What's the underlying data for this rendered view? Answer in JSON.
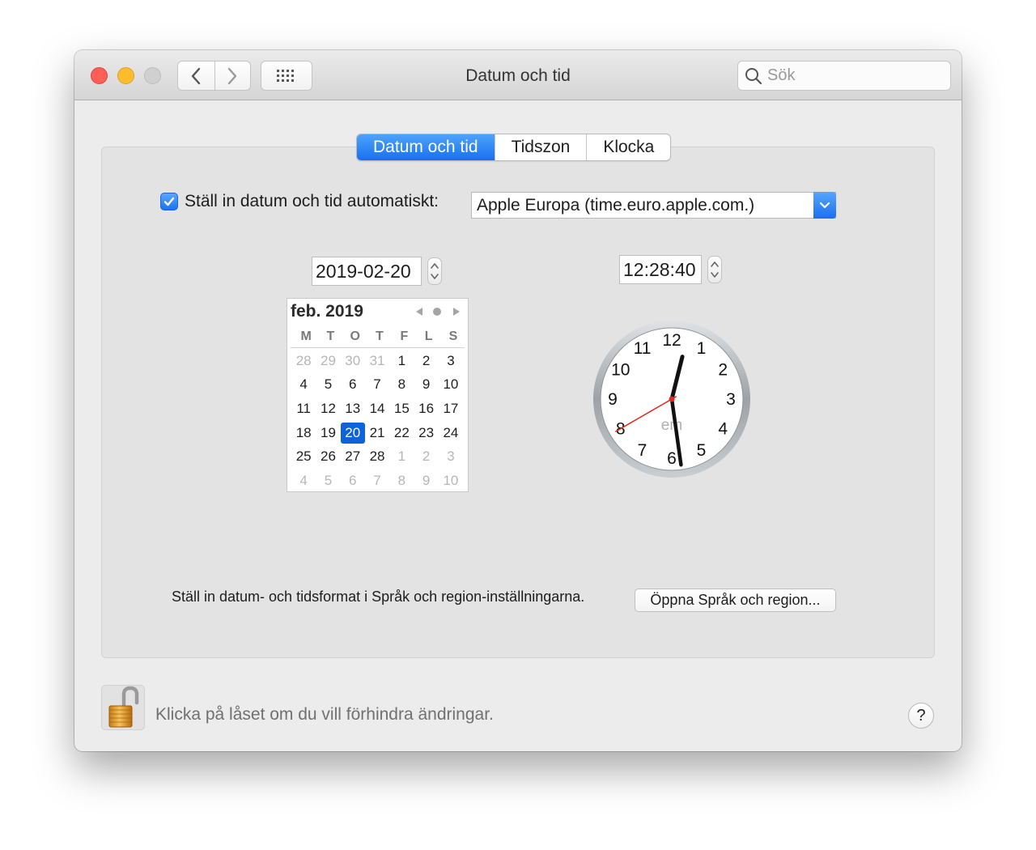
{
  "window": {
    "title": "Datum och tid",
    "search_placeholder": "Sök"
  },
  "tabs": [
    {
      "label": "Datum och tid",
      "active": true
    },
    {
      "label": "Tidszon",
      "active": false
    },
    {
      "label": "Klocka",
      "active": false
    }
  ],
  "auto": {
    "checked": true,
    "label": "Ställ in datum och tid automatiskt:",
    "server": "Apple Europa (time.euro.apple.com.)"
  },
  "date_value": "2019-02-20",
  "time_value": "12:28:40",
  "calendar": {
    "month_label": "feb. 2019",
    "weekdays": [
      "M",
      "T",
      "O",
      "T",
      "F",
      "L",
      "S"
    ],
    "weeks": [
      [
        {
          "d": "28",
          "m": true
        },
        {
          "d": "29",
          "m": true
        },
        {
          "d": "30",
          "m": true
        },
        {
          "d": "31",
          "m": true
        },
        {
          "d": "1"
        },
        {
          "d": "2"
        },
        {
          "d": "3"
        }
      ],
      [
        {
          "d": "4"
        },
        {
          "d": "5"
        },
        {
          "d": "6"
        },
        {
          "d": "7"
        },
        {
          "d": "8"
        },
        {
          "d": "9"
        },
        {
          "d": "10"
        }
      ],
      [
        {
          "d": "11"
        },
        {
          "d": "12"
        },
        {
          "d": "13"
        },
        {
          "d": "14"
        },
        {
          "d": "15"
        },
        {
          "d": "16"
        },
        {
          "d": "17"
        }
      ],
      [
        {
          "d": "18"
        },
        {
          "d": "19"
        },
        {
          "d": "20",
          "sel": true
        },
        {
          "d": "21"
        },
        {
          "d": "22"
        },
        {
          "d": "23"
        },
        {
          "d": "24"
        }
      ],
      [
        {
          "d": "25"
        },
        {
          "d": "26"
        },
        {
          "d": "27"
        },
        {
          "d": "28"
        },
        {
          "d": "1",
          "m": true
        },
        {
          "d": "2",
          "m": true
        },
        {
          "d": "3",
          "m": true
        }
      ],
      [
        {
          "d": "4",
          "m": true
        },
        {
          "d": "5",
          "m": true
        },
        {
          "d": "6",
          "m": true
        },
        {
          "d": "7",
          "m": true
        },
        {
          "d": "8",
          "m": true
        },
        {
          "d": "9",
          "m": true
        },
        {
          "d": "10",
          "m": true
        }
      ]
    ]
  },
  "clock": {
    "numbers": [
      "12",
      "1",
      "2",
      "3",
      "4",
      "5",
      "6",
      "7",
      "8",
      "9",
      "10",
      "11"
    ],
    "ampm": "em",
    "hours": 12,
    "minutes": 28,
    "seconds": 40
  },
  "format_text": "Ställ in datum- och tidsformat i Språk och region-inställningarna.",
  "open_region_label": "Öppna Språk och region...",
  "lock_text": "Klicka på låset om du vill förhindra ändringar.",
  "help_label": "?",
  "colors": {
    "accent": "#1a73ee",
    "second_hand": "#e0281c"
  }
}
